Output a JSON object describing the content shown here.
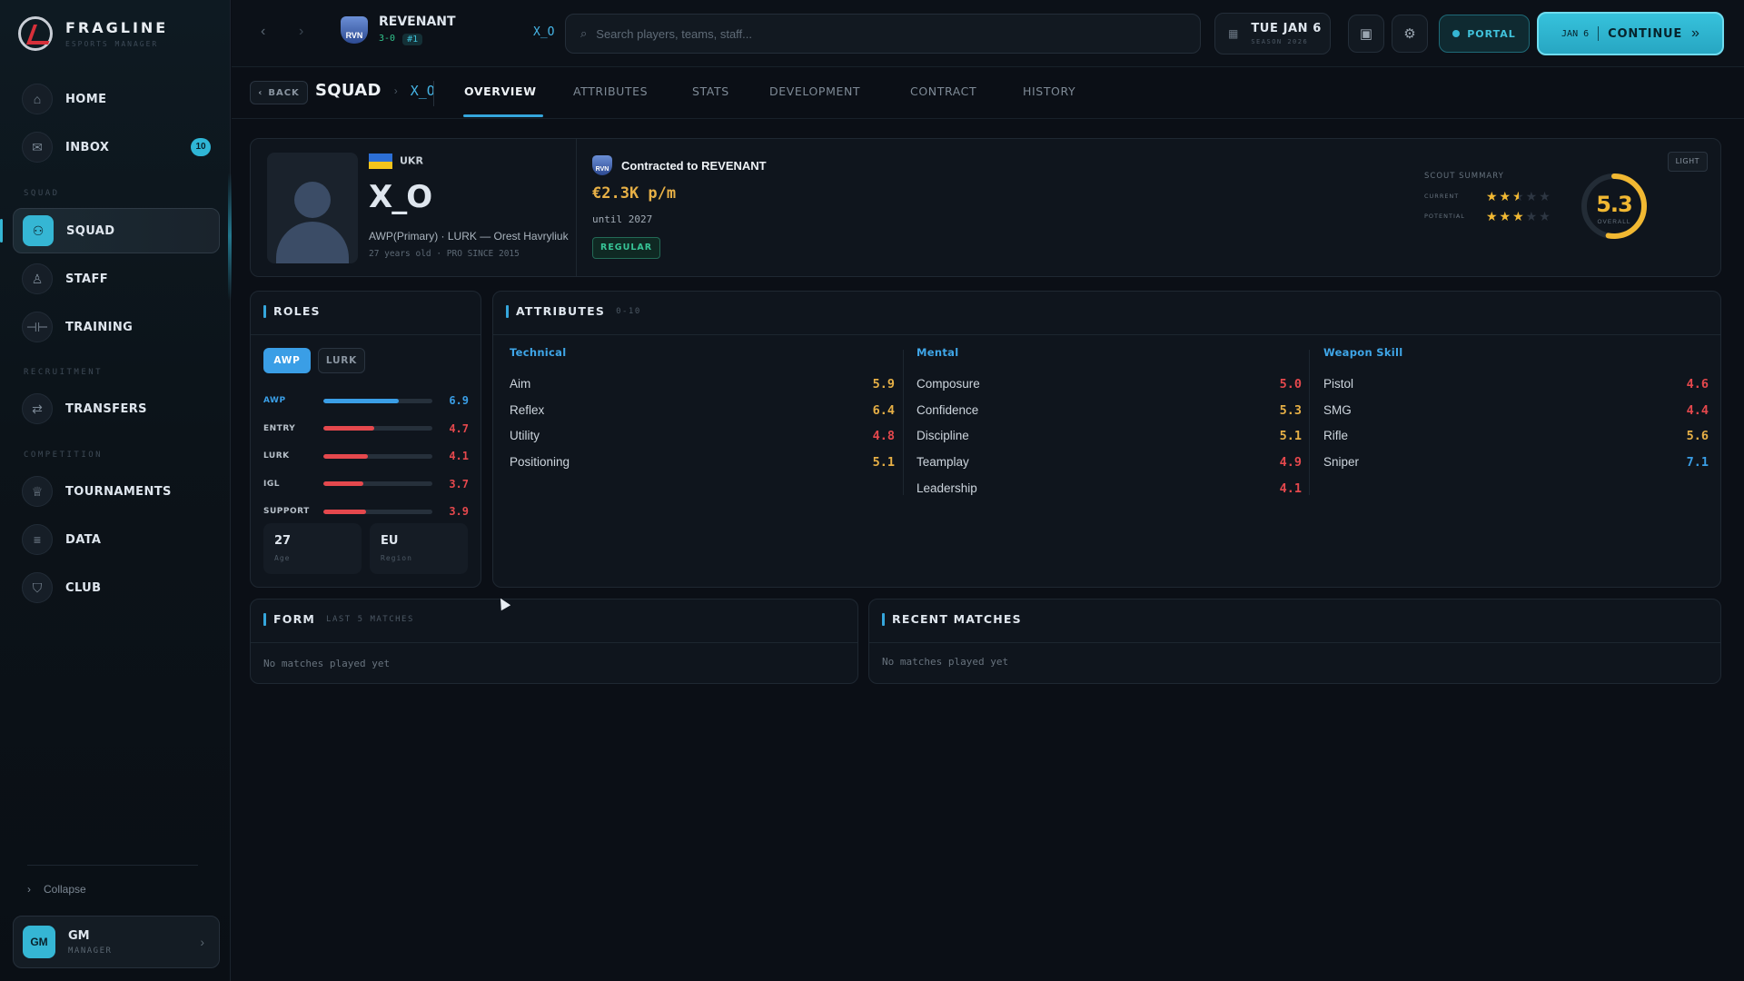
{
  "brand": {
    "name": "FRAGLINE",
    "subtitle": "ESPORTS MANAGER"
  },
  "sidebar": {
    "items": [
      {
        "label": "HOME",
        "icon": "home-icon"
      },
      {
        "label": "INBOX",
        "icon": "mail-icon",
        "badge": "10"
      },
      {
        "section": "SQUAD"
      },
      {
        "label": "SQUAD",
        "icon": "users-icon",
        "active": true
      },
      {
        "label": "STAFF",
        "icon": "user-icon"
      },
      {
        "label": "TRAINING",
        "icon": "dumbbell-icon"
      },
      {
        "section": "RECRUITMENT"
      },
      {
        "label": "TRANSFERS",
        "icon": "swap-icon"
      },
      {
        "section": "COMPETITION"
      },
      {
        "label": "TOURNAMENTS",
        "icon": "trophy-icon"
      },
      {
        "label": "DATA",
        "icon": "database-icon"
      },
      {
        "label": "CLUB",
        "icon": "shield-icon"
      }
    ],
    "collapse_label": "Collapse",
    "user": {
      "initials": "GM",
      "name": "GM",
      "role": "MANAGER"
    }
  },
  "topbar": {
    "team": {
      "abbr": "RVN",
      "name": "REVENANT",
      "record": "3-0",
      "rank": "#1"
    },
    "player_tag": "X_O",
    "search": {
      "placeholder": "Search players, teams, staff..."
    },
    "date": {
      "day": "TUE JAN 6",
      "season": "SEASON 2026"
    },
    "portal_label": "PORTAL",
    "continue": {
      "date": "JAN 6",
      "label": "CONTINUE"
    }
  },
  "subnav": {
    "back_label": "BACK",
    "breadcrumb": {
      "section": "SQUAD",
      "player": "X_O"
    },
    "tabs": [
      "OVERVIEW",
      "ATTRIBUTES",
      "STATS",
      "DEVELOPMENT",
      "CONTRACT",
      "HISTORY"
    ],
    "active_tab": "OVERVIEW"
  },
  "profile": {
    "country": "UKR",
    "name": "X_O",
    "roles_line": "AWP(Primary) · LURK — Orest Havryliuk",
    "meta": "27 years old · PRO SINCE 2015",
    "contract": {
      "team_abbr": "RVN",
      "text": "Contracted to REVENANT",
      "salary": "€2.3K p/m",
      "until": "until 2027",
      "status": "REGULAR"
    },
    "scout": {
      "title": "SCOUT SUMMARY",
      "current_label": "CURRENT",
      "current_stars": 2.5,
      "potential_label": "POTENTIAL",
      "potential_stars": 3,
      "overall": "5.3",
      "overall_label": "OVERALL",
      "overall_fraction": 0.53
    },
    "theme_label": "LIGHT"
  },
  "roles": {
    "title": "ROLES",
    "pills": [
      "AWP",
      "LURK"
    ],
    "rows": [
      {
        "name": "AWP",
        "value": "6.9",
        "color": "#3a9ee6",
        "highlight": true
      },
      {
        "name": "ENTRY",
        "value": "4.7",
        "color": "#e5484d"
      },
      {
        "name": "LURK",
        "value": "4.1",
        "color": "#e5484d"
      },
      {
        "name": "IGL",
        "value": "3.7",
        "color": "#e5484d"
      },
      {
        "name": "SUPPORT",
        "value": "3.9",
        "color": "#e5484d"
      }
    ],
    "age": {
      "value": "27",
      "label": "Age"
    },
    "region": {
      "value": "EU",
      "label": "Region"
    }
  },
  "attributes": {
    "title": "ATTRIBUTES",
    "scale": "0-10",
    "groups": [
      {
        "name": "Technical",
        "items": [
          {
            "name": "Aim",
            "value": "5.9",
            "color": "#e7b046"
          },
          {
            "name": "Reflex",
            "value": "6.4",
            "color": "#e7b046"
          },
          {
            "name": "Utility",
            "value": "4.8",
            "color": "#e5484d"
          },
          {
            "name": "Positioning",
            "value": "5.1",
            "color": "#e7b046"
          }
        ]
      },
      {
        "name": "Mental",
        "items": [
          {
            "name": "Composure",
            "value": "5.0",
            "color": "#e5484d"
          },
          {
            "name": "Confidence",
            "value": "5.3",
            "color": "#e7b046"
          },
          {
            "name": "Discipline",
            "value": "5.1",
            "color": "#e7b046"
          },
          {
            "name": "Teamplay",
            "value": "4.9",
            "color": "#e5484d"
          },
          {
            "name": "Leadership",
            "value": "4.1",
            "color": "#e5484d"
          }
        ]
      },
      {
        "name": "Weapon Skill",
        "items": [
          {
            "name": "Pistol",
            "value": "4.6",
            "color": "#e5484d"
          },
          {
            "name": "SMG",
            "value": "4.4",
            "color": "#e5484d"
          },
          {
            "name": "Rifle",
            "value": "5.6",
            "color": "#e7b046"
          },
          {
            "name": "Sniper",
            "value": "7.1",
            "color": "#3a9ee6"
          }
        ]
      }
    ]
  },
  "form": {
    "title": "FORM",
    "subtitle": "LAST 5 MATCHES",
    "empty": "No matches played yet"
  },
  "recent": {
    "title": "RECENT MATCHES",
    "empty": "No matches played yet"
  }
}
